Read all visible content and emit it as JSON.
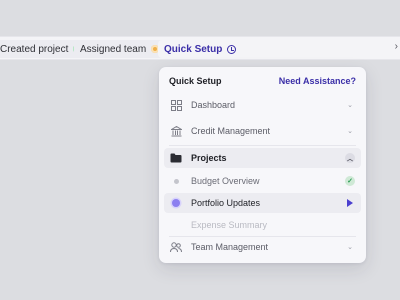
{
  "chips": [
    {
      "label": "Created project",
      "status": "complete",
      "color": "#3fbf6a"
    },
    {
      "label": "Assigned team",
      "status": "in-progress",
      "color": "#f0b04a"
    },
    {
      "label": "Quick Setup",
      "status": "active",
      "color": "#3b2fa8"
    }
  ],
  "panel": {
    "title": "Quick Setup",
    "help_link": "Need Assistance?",
    "items": [
      {
        "label": "Dashboard",
        "icon": "grid-icon"
      },
      {
        "label": "Credit Management",
        "icon": "bank-icon"
      },
      {
        "label": "Projects",
        "icon": "folder-icon",
        "expanded": true
      },
      {
        "label": "Team Management",
        "icon": "users-icon"
      }
    ],
    "subitems": [
      {
        "label": "Budget Overview",
        "status": "done"
      },
      {
        "label": "Portfolio Updates",
        "status": "current"
      },
      {
        "label": "Expense Summary",
        "status": "disabled"
      }
    ]
  },
  "accent": "#3b2fa8"
}
